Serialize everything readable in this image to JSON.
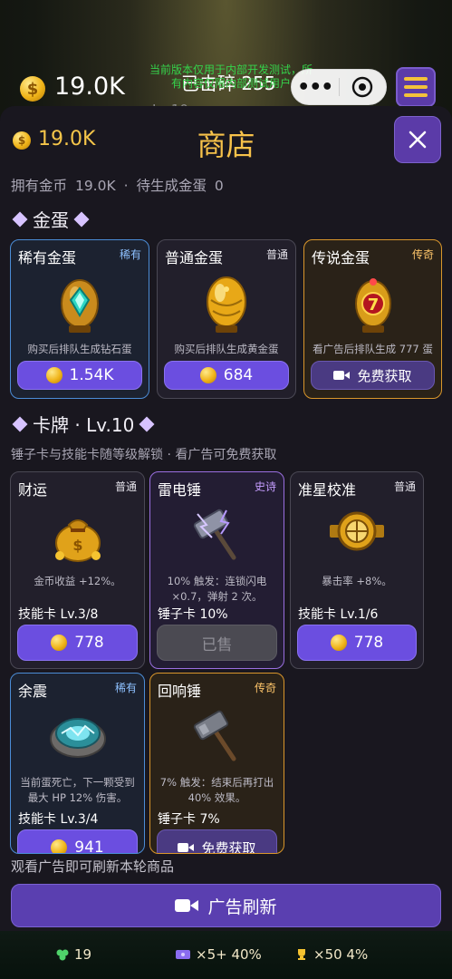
{
  "hud": {
    "coin_value": "19.0K",
    "broken_label": "已击碎 255",
    "test_note": "当前版本仅用于内部开发测试，所有内容仅限内部测试用户",
    "level_text": "Lv.10",
    "capsule_more": "•••"
  },
  "shop": {
    "title": "商店",
    "coin_value": "19.0K",
    "summary": {
      "owned_label": "拥有金币",
      "owned_value": "19.0K",
      "sep": "·",
      "pending_label": "待生成金蛋",
      "pending_value": "0"
    },
    "egg_section_title": "金蛋",
    "eggs": [
      {
        "name": "稀有金蛋",
        "rarity": "稀有",
        "desc": "购买后排队生成钻石蛋",
        "price": "1.54K",
        "icon": "diamond-egg-icon"
      },
      {
        "name": "普通金蛋",
        "rarity": "普通",
        "desc": "购买后排队生成黄金蛋",
        "price": "684",
        "icon": "golden-egg-icon"
      },
      {
        "name": "传说金蛋",
        "rarity": "传奇",
        "desc": "看广告后排队生成 777 蛋",
        "button": "免费获取",
        "icon": "lucky-777-egg-icon"
      }
    ],
    "card_section_title": "卡牌 · Lv.10",
    "card_hint": "锤子卡与技能卡随等级解锁 · 看广告可免费获取",
    "cards": [
      {
        "name": "财运",
        "rarity": "普通",
        "desc": "金币收益 +12%。",
        "type": "技能卡  Lv.3/8",
        "price": "778",
        "icon": "money-bag-icon"
      },
      {
        "name": "雷电锤",
        "rarity": "史诗",
        "desc": "10% 触发：连锁闪电 ×0.7，弹射 2 次。",
        "type": "锤子卡  10%",
        "sold": "已售",
        "icon": "thunder-hammer-icon"
      },
      {
        "name": "准星校准",
        "rarity": "普通",
        "desc": "暴击率 +8%。",
        "type": "技能卡  Lv.1/6",
        "price": "778",
        "icon": "crosshair-icon"
      },
      {
        "name": "余震",
        "rarity": "稀有",
        "desc": "当前蛋死亡，下一颗受到最大 HP 12% 伤害。",
        "type": "技能卡  Lv.3/4",
        "price": "941",
        "icon": "aftershock-rune-icon"
      },
      {
        "name": "回响锤",
        "rarity": "传奇",
        "desc": "7% 触发：结束后再打出 40% 效果。",
        "type": "锤子卡  7%",
        "button": "免费获取",
        "icon": "echo-hammer-icon"
      }
    ],
    "refresh_hint": "观看广告即可刷新本轮商品",
    "refresh_button": "广告刷新"
  },
  "bottom": {
    "stat1": "19",
    "stat2": "×5+ 40%",
    "stat3": "×50 4%"
  },
  "colors": {
    "accent_purple": "#6b4ee0",
    "gold_text": "#f7c24a",
    "rare_border": "#4b8cd6",
    "epic_border": "#9a6fe0",
    "legend_border": "#d9962b"
  }
}
